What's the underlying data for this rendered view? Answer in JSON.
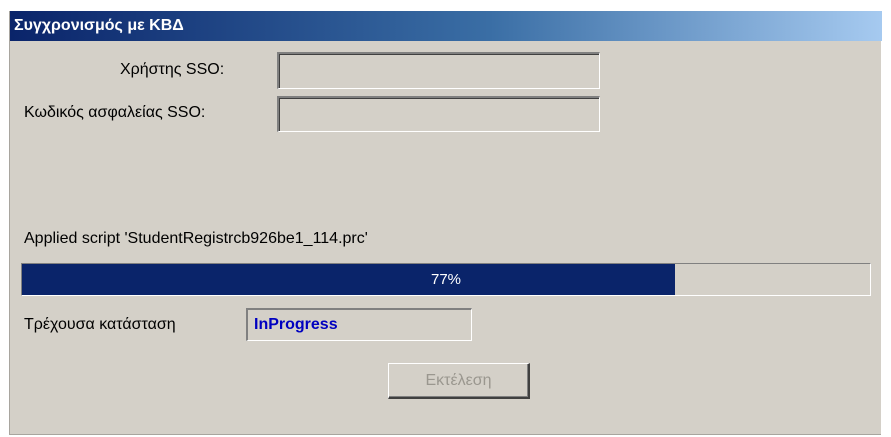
{
  "window": {
    "title": "Συγχρονισμός με ΚΒΔ"
  },
  "form": {
    "sso_user_label": "Χρήστης SSO:",
    "sso_user_value": "",
    "sso_password_label": "Κωδικός ασφαλείας SSO:",
    "sso_password_value": ""
  },
  "progress": {
    "message": "Applied script 'StudentRegistrcb926be1_114.prc'",
    "percent": 77,
    "percent_label": "77%"
  },
  "status": {
    "label": "Τρέχουσα κατάσταση",
    "value": "InProgress"
  },
  "actions": {
    "execute_label": "Εκτέλεση",
    "execute_enabled": false
  },
  "colors": {
    "title_start": "#0a246a",
    "title_end": "#a6caf0",
    "progress_fill": "#0a246a",
    "status_text": "#0000c0",
    "window_bg": "#d4d0c8",
    "disabled_text": "#9a978f"
  }
}
